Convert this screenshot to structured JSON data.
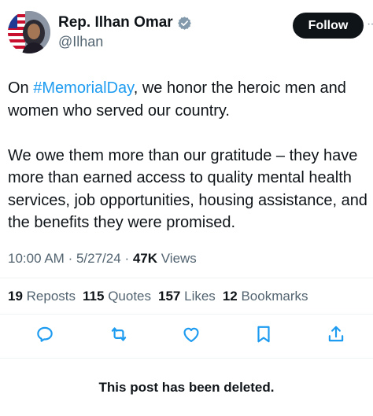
{
  "author": {
    "name": "Rep. Ilhan Omar",
    "handle": "@Ilhan",
    "avatar_icon": "profile-photo"
  },
  "follow_label": "Follow",
  "more_label": "···",
  "tweet": {
    "line1_before": "On ",
    "hashtag": "#MemorialDay",
    "line1_after": ", we honor the heroic men and women who served our country.",
    "paragraph2": "We owe them more than our gratitude – they have more than earned access to quality mental health services, job opportunities, housing assistance, and the benefits they were promised."
  },
  "meta": {
    "time": "10:00 AM",
    "sep": "·",
    "date": "5/27/24",
    "views_count": "47K",
    "views_label": "Views"
  },
  "stats": {
    "reposts_count": "19",
    "reposts_label": "Reposts",
    "quotes_count": "115",
    "quotes_label": "Quotes",
    "likes_count": "157",
    "likes_label": "Likes",
    "bookmarks_count": "12",
    "bookmarks_label": "Bookmarks"
  },
  "icons": {
    "reply": "reply-icon",
    "repost": "repost-icon",
    "like": "heart-icon",
    "bookmark": "bookmark-icon",
    "share": "share-icon",
    "verified": "verified-badge-icon"
  },
  "colors": {
    "accent": "#1d9bf0",
    "secondary_text": "#536471",
    "icon": "#1d9bf0",
    "follow_bg": "#0f1419"
  },
  "deleted_notice": "This post has been deleted."
}
